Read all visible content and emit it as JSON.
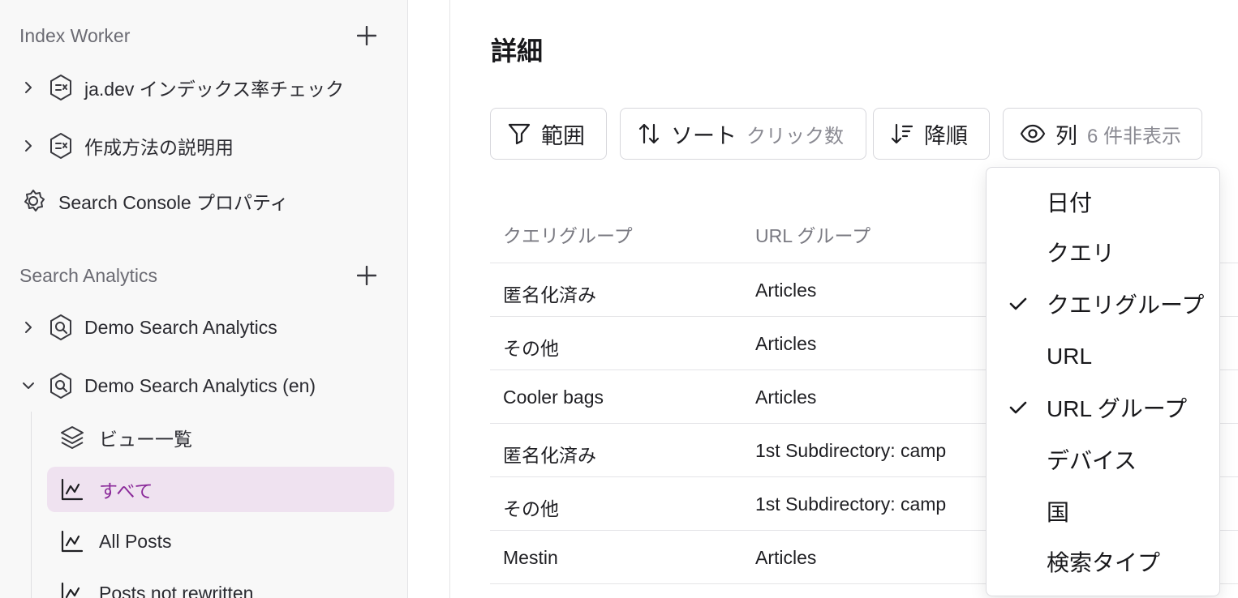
{
  "sidebar": {
    "index_worker": {
      "title": "Index Worker",
      "items": [
        {
          "label": "ja.dev インデックス率チェック"
        },
        {
          "label": "作成方法の説明用"
        }
      ]
    },
    "search_console_label": "Search Console プロパティ",
    "search_analytics": {
      "title": "Search Analytics",
      "items": [
        {
          "label": "Demo Search Analytics"
        },
        {
          "label": "Demo Search Analytics (en)"
        }
      ],
      "subitems": [
        {
          "label": "ビュー一覧"
        },
        {
          "label": "すべて"
        },
        {
          "label": "All Posts"
        },
        {
          "label": "Posts not rewritten"
        }
      ]
    }
  },
  "main": {
    "title": "詳細",
    "toolbar": {
      "range_label": "範囲",
      "sort_label": "ソート",
      "sort_value": "クリック数",
      "order_label": "降順",
      "columns_label": "列",
      "hidden_count": "6 件非表示"
    },
    "table": {
      "headers": [
        "クエリグループ",
        "URL グループ"
      ],
      "rows": [
        [
          "匿名化済み",
          "Articles"
        ],
        [
          "その他",
          "Articles"
        ],
        [
          "Cooler bags",
          "Articles"
        ],
        [
          "匿名化済み",
          "1st Subdirectory: camp"
        ],
        [
          "その他",
          "1st Subdirectory: camp"
        ],
        [
          "Mestin",
          "Articles"
        ]
      ]
    },
    "columns_menu": [
      {
        "label": "日付",
        "checked": false
      },
      {
        "label": "クエリ",
        "checked": false
      },
      {
        "label": "クエリグループ",
        "checked": true
      },
      {
        "label": "URL",
        "checked": false
      },
      {
        "label": "URL グループ",
        "checked": true
      },
      {
        "label": "デバイス",
        "checked": false
      },
      {
        "label": "国",
        "checked": false
      },
      {
        "label": "検索タイプ",
        "checked": false
      }
    ]
  },
  "colors": {
    "accent": "#8b2a9a",
    "active_bg": "#efe2f0"
  }
}
